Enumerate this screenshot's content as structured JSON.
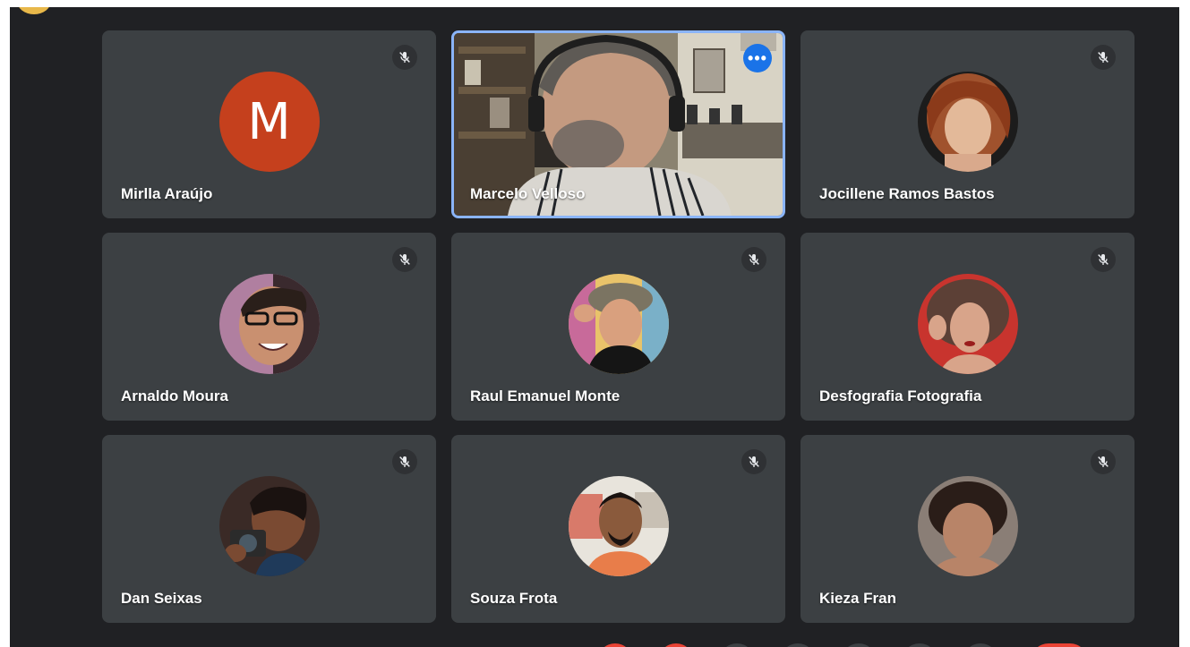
{
  "colors": {
    "background": "#202124",
    "tile": "#3c4043",
    "active_border": "#8ab4f8",
    "accent_blue": "#1a73e8",
    "leave_red": "#ea4335"
  },
  "tiles": [
    {
      "name": "Mirlla Araújo",
      "avatar_letter": "M",
      "avatar_color": "#c5401d",
      "muted": true
    },
    {
      "name": "Marcelo Velloso",
      "muted": false,
      "speaking": true
    },
    {
      "name": "Jocillene Ramos Bastos",
      "muted": true
    },
    {
      "name": "Arnaldo Moura",
      "muted": true
    },
    {
      "name": "Raul Emanuel Monte",
      "muted": true
    },
    {
      "name": "Desfografia Fotografia",
      "muted": true
    },
    {
      "name": "Dan Seixas",
      "muted": true
    },
    {
      "name": "Souza Frota",
      "muted": true
    },
    {
      "name": "Kieza Fran",
      "muted": true
    }
  ],
  "icons": {
    "mute": "mic-off-icon",
    "more": "more-options-icon"
  },
  "more_glyph": "•••"
}
